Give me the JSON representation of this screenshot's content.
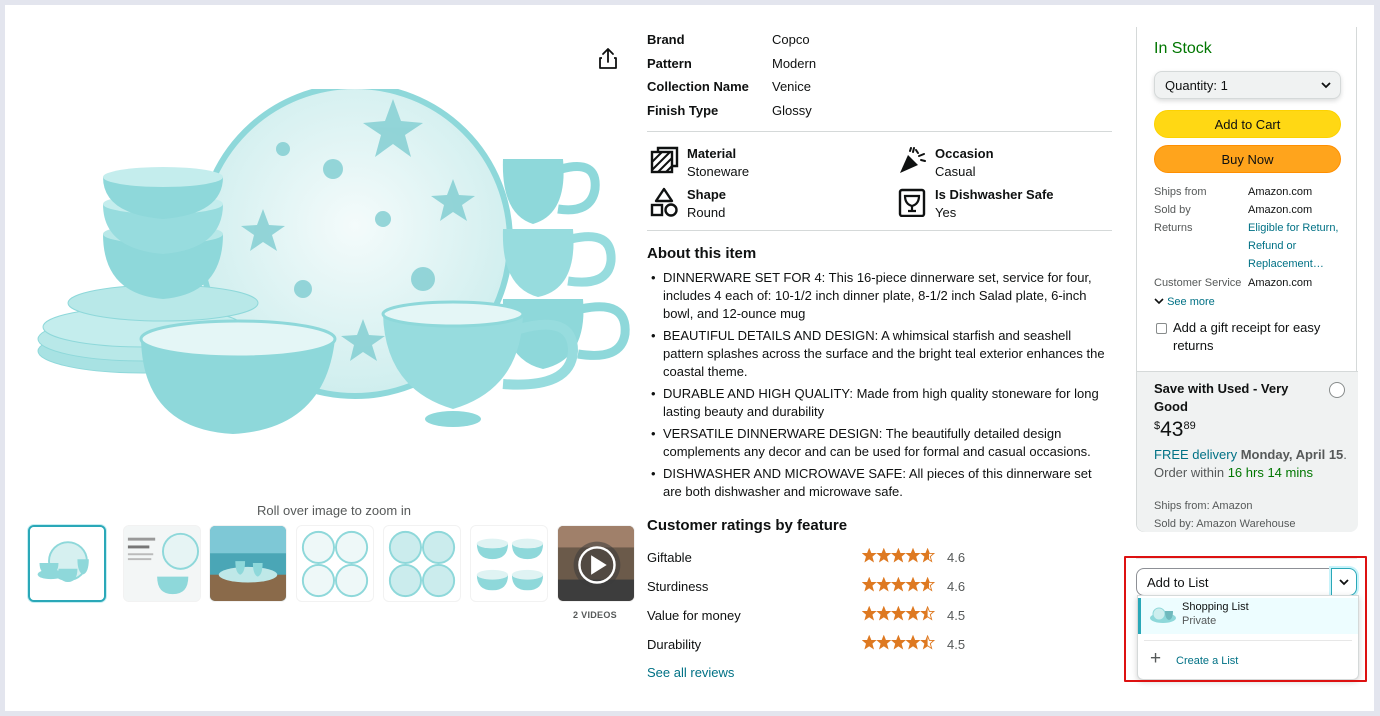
{
  "gallery": {
    "zoom_hint": "Roll over image to zoom in",
    "video_count_label": "2 VIDEOS",
    "thumbnails": [
      "main-set",
      "pattern-card",
      "lifestyle",
      "plates-pattern",
      "salad-plates",
      "bowls",
      "video"
    ]
  },
  "specs": [
    {
      "key": "Brand",
      "value": "Copco"
    },
    {
      "key": "Pattern",
      "value": "Modern"
    },
    {
      "key": "Collection Name",
      "value": "Venice"
    },
    {
      "key": "Finish Type",
      "value": "Glossy"
    }
  ],
  "features": [
    {
      "title": "Material",
      "value": "Stoneware",
      "icon": "material-icon"
    },
    {
      "title": "Occasion",
      "value": "Casual",
      "icon": "party-popper-icon"
    },
    {
      "title": "Shape",
      "value": "Round",
      "icon": "shapes-icon"
    },
    {
      "title": "Is Dishwasher Safe",
      "value": "Yes",
      "icon": "dishwasher-icon"
    }
  ],
  "about": {
    "title": "About this item",
    "bullets": [
      "DINNERWARE SET FOR 4: This 16-piece dinnerware set, service for four, includes 4 each of: 10-1/2 inch dinner plate, 8-1/2 inch Salad plate, 6-inch bowl, and 12-ounce mug",
      "BEAUTIFUL DETAILS AND DESIGN: A whimsical starfish and seashell pattern splashes across the surface and the bright teal exterior enhances the coastal theme.",
      "DURABLE AND HIGH QUALITY: Made from high quality stoneware for long lasting beauty and durability",
      "VERSATILE DINNERWARE DESIGN: The beautifully detailed design complements any decor and can be used for formal and casual occasions.",
      "DISHWASHER AND MICROWAVE SAFE: All pieces of this dinnerware set are both dishwasher and microwave safe."
    ]
  },
  "ratings": {
    "title": "Customer ratings by feature",
    "items": [
      {
        "label": "Giftable",
        "value": "4.6",
        "stars": 4.6
      },
      {
        "label": "Sturdiness",
        "value": "4.6",
        "stars": 4.6
      },
      {
        "label": "Value for money",
        "value": "4.5",
        "stars": 4.5
      },
      {
        "label": "Durability",
        "value": "4.5",
        "stars": 4.5
      }
    ],
    "see_all": "See all reviews"
  },
  "buybox": {
    "stock": "In Stock",
    "quantity": "Quantity: 1",
    "add_to_cart": "Add to Cart",
    "buy_now": "Buy Now",
    "ships_from_label": "Ships from",
    "ships_from": "Amazon.com",
    "sold_by_label": "Sold by",
    "sold_by": "Amazon.com",
    "returns_label": "Returns",
    "returns": "Eligible for Return, Refund or Replacement…",
    "customer_service_label": "Customer Service",
    "customer_service": "Amazon.com",
    "see_more": "See more",
    "gift": "Add a gift receipt for easy returns",
    "used": {
      "title": "Save with Used - Very Good",
      "price_symbol": "$",
      "price_whole": "43",
      "price_fraction": "89",
      "free_delivery": "FREE delivery",
      "delivery_date": "Monday, April 15",
      "order_within": "Order within",
      "timer": "16 hrs 14 mins",
      "ships_from": "Ships from: Amazon",
      "sold_by": "Sold by: Amazon Warehouse"
    }
  },
  "add_to_list": {
    "label": "Add to List",
    "menu": [
      {
        "name": "Shopping List",
        "privacy": "Private"
      }
    ],
    "create": "Create a List"
  },
  "colors": {
    "accent": "#007185",
    "in_stock": "#007600",
    "cart_button": "#FFD814",
    "buy_button": "#FFA41C",
    "star": "#DE7921",
    "highlight": "#DD1111",
    "product_teal": "#8ED8DA"
  }
}
